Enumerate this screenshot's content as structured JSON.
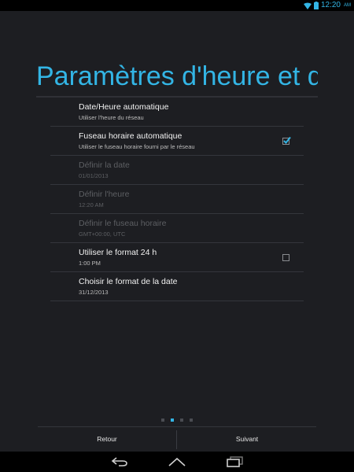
{
  "status_bar": {
    "time": "12:20",
    "ampm": "AM",
    "icons": [
      "wifi-icon",
      "battery-icon"
    ]
  },
  "page": {
    "title": "Paramètres d'heure et d"
  },
  "settings": [
    {
      "title": "Date/Heure automatique",
      "subtitle": "Utiliser l'heure du réseau",
      "enabled": true,
      "checkbox": "none"
    },
    {
      "title": "Fuseau horaire automatique",
      "subtitle": "Utiliser le fuseau horaire fourni par le réseau",
      "enabled": true,
      "checkbox": "checked"
    },
    {
      "title": "Définir la date",
      "subtitle": "01/01/2013",
      "enabled": false,
      "checkbox": "none"
    },
    {
      "title": "Définir l'heure",
      "subtitle": "12:20 AM",
      "enabled": false,
      "checkbox": "none"
    },
    {
      "title": "Définir le fuseau horaire",
      "subtitle": "GMT+00:00, UTC",
      "enabled": false,
      "checkbox": "none"
    },
    {
      "title": "Utiliser le format 24 h",
      "subtitle": "1:00 PM",
      "enabled": true,
      "checkbox": "unchecked"
    },
    {
      "title": "Choisir le format de la date",
      "subtitle": "31/12/2013",
      "enabled": true,
      "checkbox": "none"
    }
  ],
  "pager": {
    "count": 4,
    "active_index": 1
  },
  "actions": {
    "back_label": "Retour",
    "next_label": "Suivant"
  },
  "nav_icons": [
    "back-nav-icon",
    "home-nav-icon",
    "recent-apps-icon"
  ],
  "colors": {
    "accent": "#33b5e5",
    "background": "#1d1e22"
  }
}
